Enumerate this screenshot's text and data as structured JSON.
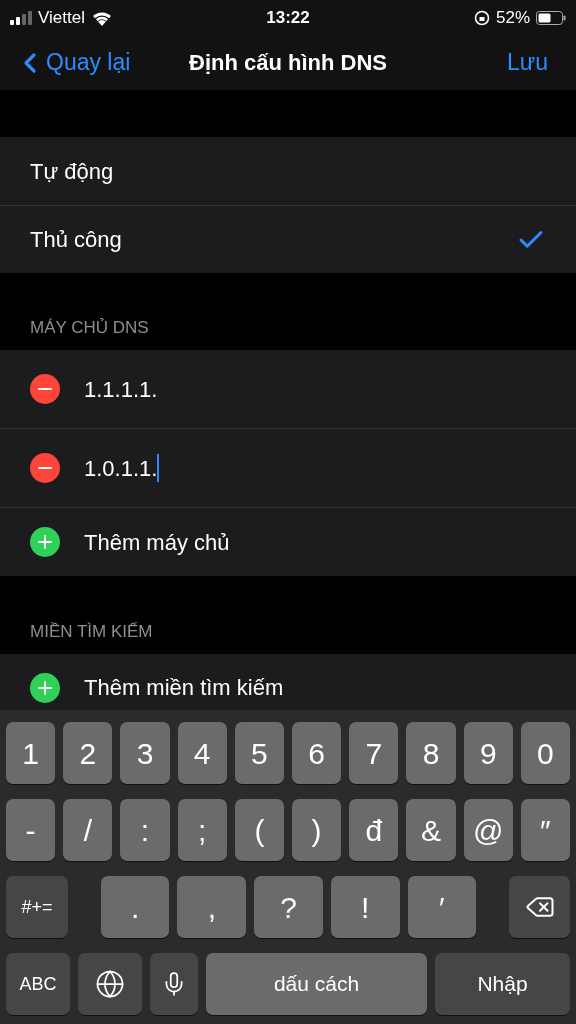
{
  "status_bar": {
    "carrier": "Viettel",
    "time": "13:22",
    "battery": "52%"
  },
  "nav": {
    "back": "Quay lại",
    "title": "Định cấu hình DNS",
    "action": "Lưu"
  },
  "modes": [
    {
      "label": "Tự động",
      "selected": false
    },
    {
      "label": "Thủ công",
      "selected": true
    }
  ],
  "dns_section": {
    "header": "MÁY CHỦ DNS",
    "servers": [
      {
        "value": "1.1.1.1.",
        "focused": false
      },
      {
        "value": "1.0.1.1.",
        "focused": true
      }
    ],
    "add": "Thêm máy chủ"
  },
  "search_section": {
    "header": "MIỀN TÌM KIẾM",
    "add": "Thêm miền tìm kiếm"
  },
  "keyboard": [
    [
      {
        "kind": "char",
        "label": "1"
      },
      {
        "kind": "char",
        "label": "2"
      },
      {
        "kind": "char",
        "label": "3"
      },
      {
        "kind": "char",
        "label": "4"
      },
      {
        "kind": "char",
        "label": "5"
      },
      {
        "kind": "char",
        "label": "6"
      },
      {
        "kind": "char",
        "label": "7"
      },
      {
        "kind": "char",
        "label": "8"
      },
      {
        "kind": "char",
        "label": "9"
      },
      {
        "kind": "char",
        "label": "0"
      }
    ],
    [
      {
        "kind": "char",
        "label": "-"
      },
      {
        "kind": "char",
        "label": "/"
      },
      {
        "kind": "char",
        "label": ":"
      },
      {
        "kind": "char",
        "label": ";"
      },
      {
        "kind": "char",
        "label": "("
      },
      {
        "kind": "char",
        "label": ")"
      },
      {
        "kind": "char",
        "label": "đ"
      },
      {
        "kind": "char",
        "label": "&"
      },
      {
        "kind": "char",
        "label": "@"
      },
      {
        "kind": "char",
        "label": "″"
      }
    ],
    [
      {
        "kind": "shift",
        "label": "#+="
      },
      {
        "kind": "wide",
        "label": "."
      },
      {
        "kind": "wide",
        "label": ","
      },
      {
        "kind": "wide",
        "label": "?"
      },
      {
        "kind": "wide",
        "label": "!"
      },
      {
        "kind": "wide",
        "label": "′"
      },
      {
        "kind": "delete"
      }
    ],
    [
      {
        "kind": "abc",
        "label": "ABC"
      },
      {
        "kind": "globe"
      },
      {
        "kind": "mic"
      },
      {
        "kind": "space",
        "label": "dấu cách"
      },
      {
        "kind": "return",
        "label": "Nhập"
      }
    ]
  ]
}
